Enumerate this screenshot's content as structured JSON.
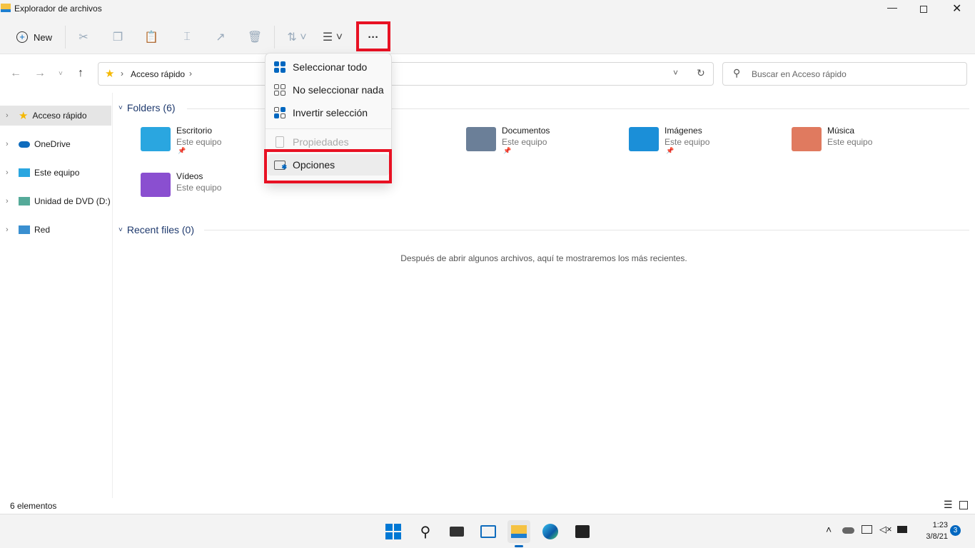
{
  "window": {
    "title": "Explorador de archivos"
  },
  "toolbar": {
    "new_label": "New",
    "more_label": "···",
    "icons": [
      "cut-icon",
      "copy-icon",
      "paste-icon",
      "rename-icon",
      "share-icon",
      "delete-icon",
      "sort-icon",
      "view-icon"
    ]
  },
  "address": {
    "location": "Acceso rápido",
    "search_placeholder": "Buscar en Acceso rápido"
  },
  "sidebar": {
    "items": [
      {
        "label": "Acceso rápido"
      },
      {
        "label": "OneDrive"
      },
      {
        "label": "Este equipo"
      },
      {
        "label": "Unidad de DVD (D:) C"
      },
      {
        "label": "Red"
      }
    ]
  },
  "main": {
    "folders_header": "Folders (6)",
    "folders": [
      {
        "name": "Escritorio",
        "location": "Este equipo",
        "color": "#2aa6e0"
      },
      {
        "name": "Documentos",
        "location": "Este equipo",
        "color": "#6b7f98"
      },
      {
        "name": "Imágenes",
        "location": "Este equipo",
        "color": "#1b8fd8"
      },
      {
        "name": "Música",
        "location": "Este equipo",
        "color": "#e07a5f"
      },
      {
        "name": "Vídeos",
        "location": "Este equipo",
        "color": "#8a4fd0"
      }
    ],
    "recent_header": "Recent files (0)",
    "recent_empty": "Después de abrir algunos archivos, aquí te mostraremos los más recientes."
  },
  "menu": {
    "items": [
      {
        "label": "Seleccionar todo"
      },
      {
        "label": "No seleccionar nada"
      },
      {
        "label": "Invertir selección"
      },
      {
        "label": "Propiedades",
        "disabled": true
      },
      {
        "label": "Opciones"
      }
    ]
  },
  "status": {
    "count": "6 elementos"
  },
  "taskbar": {
    "time": "1:23",
    "date": "3/8/21",
    "notifications": "3"
  },
  "colors": {
    "accent": "#0067c0",
    "highlight": "#e81123"
  }
}
